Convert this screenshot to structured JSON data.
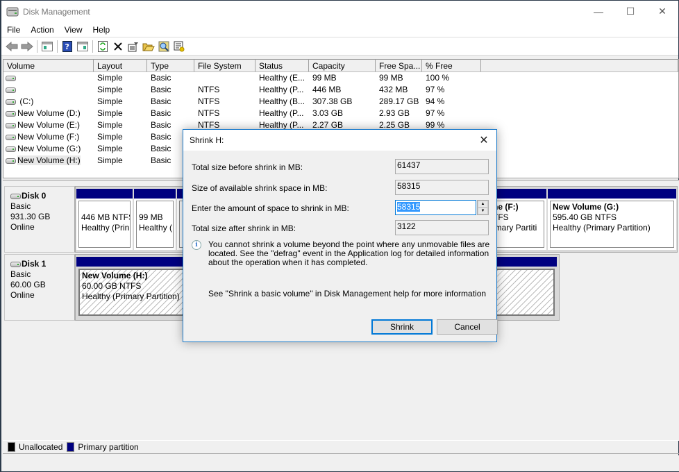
{
  "window": {
    "title": "Disk Management",
    "controls": {
      "minimize": "—",
      "maximize": "☐",
      "close": "✕"
    }
  },
  "menu": [
    "File",
    "Action",
    "View",
    "Help"
  ],
  "toolbar": {
    "icons": [
      "back-icon",
      "forward-icon",
      "show-hide-console-tree-icon",
      "help-icon",
      "show-hide-action-pane-icon",
      "refresh-icon",
      "delete-icon",
      "properties-icon",
      "open-icon",
      "rescan-icon",
      "settings-icon"
    ]
  },
  "volumes": {
    "columns": [
      "Volume",
      "Layout",
      "Type",
      "File System",
      "Status",
      "Capacity",
      "Free Spa...",
      "% Free"
    ],
    "rows": [
      {
        "volume": "",
        "layout": "Simple",
        "type": "Basic",
        "fs": "",
        "status": "Healthy (E...",
        "capacity": "99 MB",
        "free": "99 MB",
        "pct": "100 %"
      },
      {
        "volume": "",
        "layout": "Simple",
        "type": "Basic",
        "fs": "NTFS",
        "status": "Healthy (P...",
        "capacity": "446 MB",
        "free": "432 MB",
        "pct": "97 %"
      },
      {
        "volume": " (C:)",
        "layout": "Simple",
        "type": "Basic",
        "fs": "NTFS",
        "status": "Healthy (B...",
        "capacity": "307.38 GB",
        "free": "289.17 GB",
        "pct": "94 %"
      },
      {
        "volume": "New Volume (D:)",
        "layout": "Simple",
        "type": "Basic",
        "fs": "NTFS",
        "status": "Healthy (P...",
        "capacity": "3.03 GB",
        "free": "2.93 GB",
        "pct": "97 %"
      },
      {
        "volume": "New Volume (E:)",
        "layout": "Simple",
        "type": "Basic",
        "fs": "NTFS",
        "status": "Healthy (P...",
        "capacity": "2.27 GB",
        "free": "2.25 GB",
        "pct": "99 %"
      },
      {
        "volume": "New Volume (F:)",
        "layout": "Simple",
        "type": "Basic",
        "fs": "",
        "status": "",
        "capacity": "",
        "free": "",
        "pct": ""
      },
      {
        "volume": "New Volume (G:)",
        "layout": "Simple",
        "type": "Basic",
        "fs": "",
        "status": "",
        "capacity": "",
        "free": "",
        "pct": ""
      },
      {
        "volume": "New Volume (H:)",
        "layout": "Simple",
        "type": "Basic",
        "fs": "",
        "status": "",
        "capacity": "",
        "free": "",
        "pct": ""
      }
    ]
  },
  "disks": [
    {
      "name": "Disk 0",
      "type": "Basic",
      "size": "931.30 GB",
      "state": "Online",
      "partitions": [
        {
          "title": "",
          "line1": "446 MB NTFS",
          "line2": "Healthy (Prin"
        },
        {
          "title": "",
          "line1": "99 MB",
          "line2": "Healthy ("
        },
        {
          "title": "ne  (F:)",
          "line1": "TFS",
          "line2": "imary Partiti"
        },
        {
          "title": "New Volume  (G:)",
          "line1": "595.40 GB NTFS",
          "line2": "Healthy (Primary Partition)"
        }
      ]
    },
    {
      "name": "Disk 1",
      "type": "Basic",
      "size": "60.00 GB",
      "state": "Online",
      "partitions": [
        {
          "title": "New Volume  (H:)",
          "line1": "60.00 GB NTFS",
          "line2": "Healthy (Primary Partition)"
        }
      ]
    }
  ],
  "legend": [
    {
      "label": "Unallocated",
      "color": "#000000"
    },
    {
      "label": "Primary partition",
      "color": "#000080"
    }
  ],
  "dialog": {
    "title": "Shrink H:",
    "close": "✕",
    "total_before_label": "Total size before shrink in MB:",
    "total_before_value": "61437",
    "available_label": "Size of available shrink space in MB:",
    "available_value": "58315",
    "amount_label": "Enter the amount of space to shrink in MB:",
    "amount_value": "58315",
    "total_after_label": "Total size after shrink in MB:",
    "total_after_value": "3122",
    "info_text": "You cannot shrink a volume beyond the point where any unmovable files are located. See the \"defrag\" event in the Application log for detailed information about the operation when it has completed.",
    "help_text": "See \"Shrink a basic volume\" in Disk Management help for more information",
    "shrink_button": "Shrink",
    "cancel_button": "Cancel"
  }
}
